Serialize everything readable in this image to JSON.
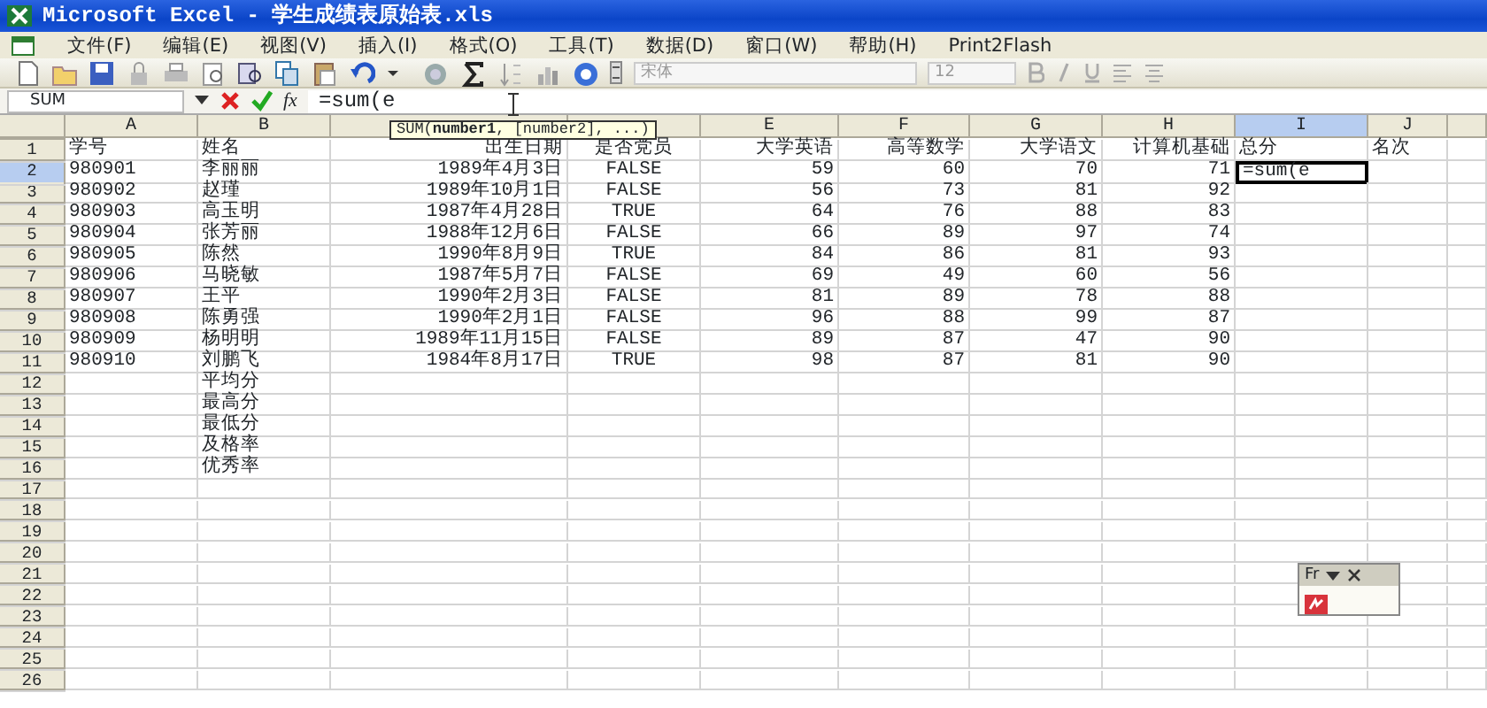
{
  "window": {
    "title": "Microsoft Excel - 学生成绩表原始表.xls"
  },
  "menu": [
    "文件(F)",
    "编辑(E)",
    "视图(V)",
    "插入(I)",
    "格式(O)",
    "工具(T)",
    "数据(D)",
    "窗口(W)",
    "帮助(H)",
    "Print2Flash"
  ],
  "toolbar": {
    "font_name": "宋体",
    "font_size": "12"
  },
  "formula_bar": {
    "name_box": "SUM",
    "function_button": "fx",
    "formula": "=sum(e",
    "tooltip": "SUM(**number1**, [number2], ...)"
  },
  "sheet": {
    "columns": [
      {
        "label": "A",
        "selected": false,
        "kind": "text"
      },
      {
        "label": "B",
        "selected": false,
        "kind": "text"
      },
      {
        "selected": false,
        "kind": "date"
      },
      {
        "selected": false,
        "kind": "bool"
      },
      {
        "label": "E",
        "selected": false,
        "kind": "number"
      },
      {
        "label": "F",
        "selected": false,
        "kind": "number"
      },
      {
        "label": "G",
        "selected": false,
        "kind": "number"
      },
      {
        "label": "H",
        "selected": false,
        "kind": "number"
      },
      {
        "label": "I",
        "selected": true,
        "kind": "text"
      },
      {
        "label": "J",
        "selected": false,
        "kind": "text"
      },
      {
        "selected": false,
        "kind": "text"
      }
    ],
    "rows": [
      {
        "label": "1",
        "selected": false,
        "cells": [
          {
            "text": "学号"
          },
          {
            "text": "姓名"
          },
          {
            "text": "出生日期"
          },
          {
            "text": "是否党员"
          },
          {
            "text": "大学英语"
          },
          {
            "text": "高等数学"
          },
          {
            "text": "大学语文"
          },
          {
            "text": "计算机基础"
          },
          {
            "text": "总分"
          },
          {
            "text": "名次"
          }
        ]
      },
      {
        "label": "2",
        "selected": true,
        "cells": [
          {
            "text": "980901"
          },
          {
            "text": "李丽丽"
          },
          {
            "text": "1989年4月3日"
          },
          {
            "text": "FALSE"
          },
          {
            "text": "59"
          },
          {
            "text": "60"
          },
          {
            "text": "70"
          },
          {
            "text": "71"
          },
          {
            "text": "=sum(e",
            "editing": true
          }
        ]
      },
      {
        "label": "3",
        "selected": false,
        "cells": [
          {
            "text": "980902"
          },
          {
            "text": "赵瑾"
          },
          {
            "text": "1989年10月1日"
          },
          {
            "text": "FALSE"
          },
          {
            "text": "56"
          },
          {
            "text": "73"
          },
          {
            "text": "81"
          },
          {
            "text": "92"
          }
        ]
      },
      {
        "label": "4",
        "selected": false,
        "cells": [
          {
            "text": "980903"
          },
          {
            "text": "高玉明"
          },
          {
            "text": "1987年4月28日"
          },
          {
            "text": "TRUE"
          },
          {
            "text": "64"
          },
          {
            "text": "76"
          },
          {
            "text": "88"
          },
          {
            "text": "83"
          }
        ]
      },
      {
        "label": "5",
        "selected": false,
        "cells": [
          {
            "text": "980904"
          },
          {
            "text": "张芳丽"
          },
          {
            "text": "1988年12月6日"
          },
          {
            "text": "FALSE"
          },
          {
            "text": "66"
          },
          {
            "text": "89"
          },
          {
            "text": "97"
          },
          {
            "text": "74"
          }
        ]
      },
      {
        "label": "6",
        "selected": false,
        "cells": [
          {
            "text": "980905"
          },
          {
            "text": "陈然"
          },
          {
            "text": "1990年8月9日"
          },
          {
            "text": "TRUE"
          },
          {
            "text": "84"
          },
          {
            "text": "86"
          },
          {
            "text": "81"
          },
          {
            "text": "93"
          }
        ]
      },
      {
        "label": "7",
        "selected": false,
        "cells": [
          {
            "text": "980906"
          },
          {
            "text": "马晓敏"
          },
          {
            "text": "1987年5月7日"
          },
          {
            "text": "FALSE"
          },
          {
            "text": "69"
          },
          {
            "text": "49"
          },
          {
            "text": "60"
          },
          {
            "text": "56"
          }
        ]
      },
      {
        "label": "8",
        "selected": false,
        "cells": [
          {
            "text": "980907"
          },
          {
            "text": "王平"
          },
          {
            "text": "1990年2月3日"
          },
          {
            "text": "FALSE"
          },
          {
            "text": "81"
          },
          {
            "text": "89"
          },
          {
            "text": "78"
          },
          {
            "text": "88"
          }
        ]
      },
      {
        "label": "9",
        "selected": false,
        "cells": [
          {
            "text": "980908"
          },
          {
            "text": "陈勇强"
          },
          {
            "text": "1990年2月1日"
          },
          {
            "text": "FALSE"
          },
          {
            "text": "96"
          },
          {
            "text": "88"
          },
          {
            "text": "99"
          },
          {
            "text": "87"
          }
        ]
      },
      {
        "label": "10",
        "selected": false,
        "cells": [
          {
            "text": "980909"
          },
          {
            "text": "杨明明"
          },
          {
            "text": "1989年11月15日"
          },
          {
            "text": "FALSE"
          },
          {
            "text": "89"
          },
          {
            "text": "87"
          },
          {
            "text": "47"
          },
          {
            "text": "90"
          }
        ]
      },
      {
        "label": "11",
        "selected": false,
        "cells": [
          {
            "text": "980910"
          },
          {
            "text": "刘鹏飞"
          },
          {
            "text": "1984年8月17日"
          },
          {
            "text": "TRUE"
          },
          {
            "text": "98"
          },
          {
            "text": "87"
          },
          {
            "text": "81"
          },
          {
            "text": "90"
          }
        ]
      },
      {
        "label": "12",
        "selected": false,
        "cells": [
          {},
          {
            "text": "平均分"
          }
        ]
      },
      {
        "label": "13",
        "selected": false,
        "cells": [
          {},
          {
            "text": "最高分"
          }
        ]
      },
      {
        "label": "14",
        "selected": false,
        "cells": [
          {},
          {
            "text": "最低分"
          }
        ]
      },
      {
        "label": "15",
        "selected": false,
        "cells": [
          {},
          {
            "text": "及格率"
          }
        ]
      },
      {
        "label": "16",
        "selected": false,
        "cells": [
          {},
          {
            "text": "优秀率"
          }
        ]
      },
      {
        "label": "17",
        "selected": false,
        "cells": []
      },
      {
        "label": "18",
        "selected": false,
        "cells": []
      },
      {
        "label": "19",
        "selected": false,
        "cells": []
      },
      {
        "label": "20",
        "selected": false,
        "cells": []
      },
      {
        "label": "21",
        "selected": false,
        "cells": []
      },
      {
        "label": "22",
        "selected": false,
        "cells": []
      },
      {
        "label": "23",
        "selected": false,
        "cells": []
      },
      {
        "label": "24",
        "selected": false,
        "cells": []
      },
      {
        "label": "25",
        "selected": false,
        "cells": []
      },
      {
        "label": "26",
        "selected": false,
        "cells": []
      }
    ]
  },
  "floating_toolbar": {
    "title": "Fr"
  }
}
